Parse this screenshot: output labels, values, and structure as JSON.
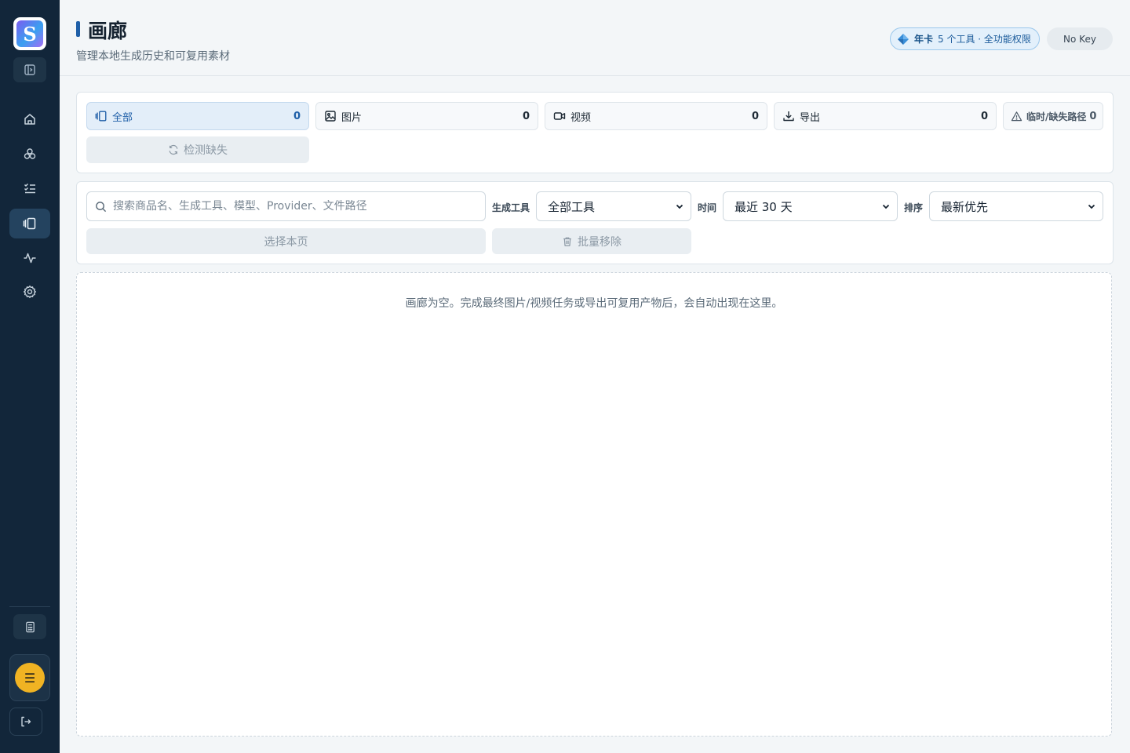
{
  "sidebar": {
    "logo_letter": "S",
    "nav": [
      {
        "name": "home-icon"
      },
      {
        "name": "modules-icon"
      },
      {
        "name": "tasks-icon"
      },
      {
        "name": "gallery-icon",
        "active": true
      },
      {
        "name": "activity-icon"
      },
      {
        "name": "settings-icon"
      }
    ],
    "avatar_glyph": "☰"
  },
  "header": {
    "title": "画廊",
    "subtitle": "管理本地生成历史和可复用素材",
    "plan_name": "年卡",
    "plan_desc": "5 个工具 · 全功能权限",
    "key_status": "No Key"
  },
  "tabs": [
    {
      "label": "全部",
      "count": "0",
      "icon": "gallery-icon",
      "active": true
    },
    {
      "label": "图片",
      "count": "0",
      "icon": "image-icon"
    },
    {
      "label": "视频",
      "count": "0",
      "icon": "video-icon"
    },
    {
      "label": "导出",
      "count": "0",
      "icon": "download-icon"
    },
    {
      "label": "临时/缺失路径",
      "count": "0",
      "icon": "warning-icon"
    }
  ],
  "check_missing_label": "检测缺失",
  "search": {
    "placeholder": "搜索商品名、生成工具、模型、Provider、文件路径"
  },
  "filters": {
    "tool_label": "生成工具",
    "tool_value": "全部工具",
    "time_label": "时间",
    "time_value": "最近 30 天",
    "sort_label": "排序",
    "sort_value": "最新优先"
  },
  "actions": {
    "select_page": "选择本页",
    "batch_remove": "批量移除"
  },
  "empty_message": "画廊为空。完成最终图片/视频任务或导出可复用产物后，会自动出现在这里。"
}
